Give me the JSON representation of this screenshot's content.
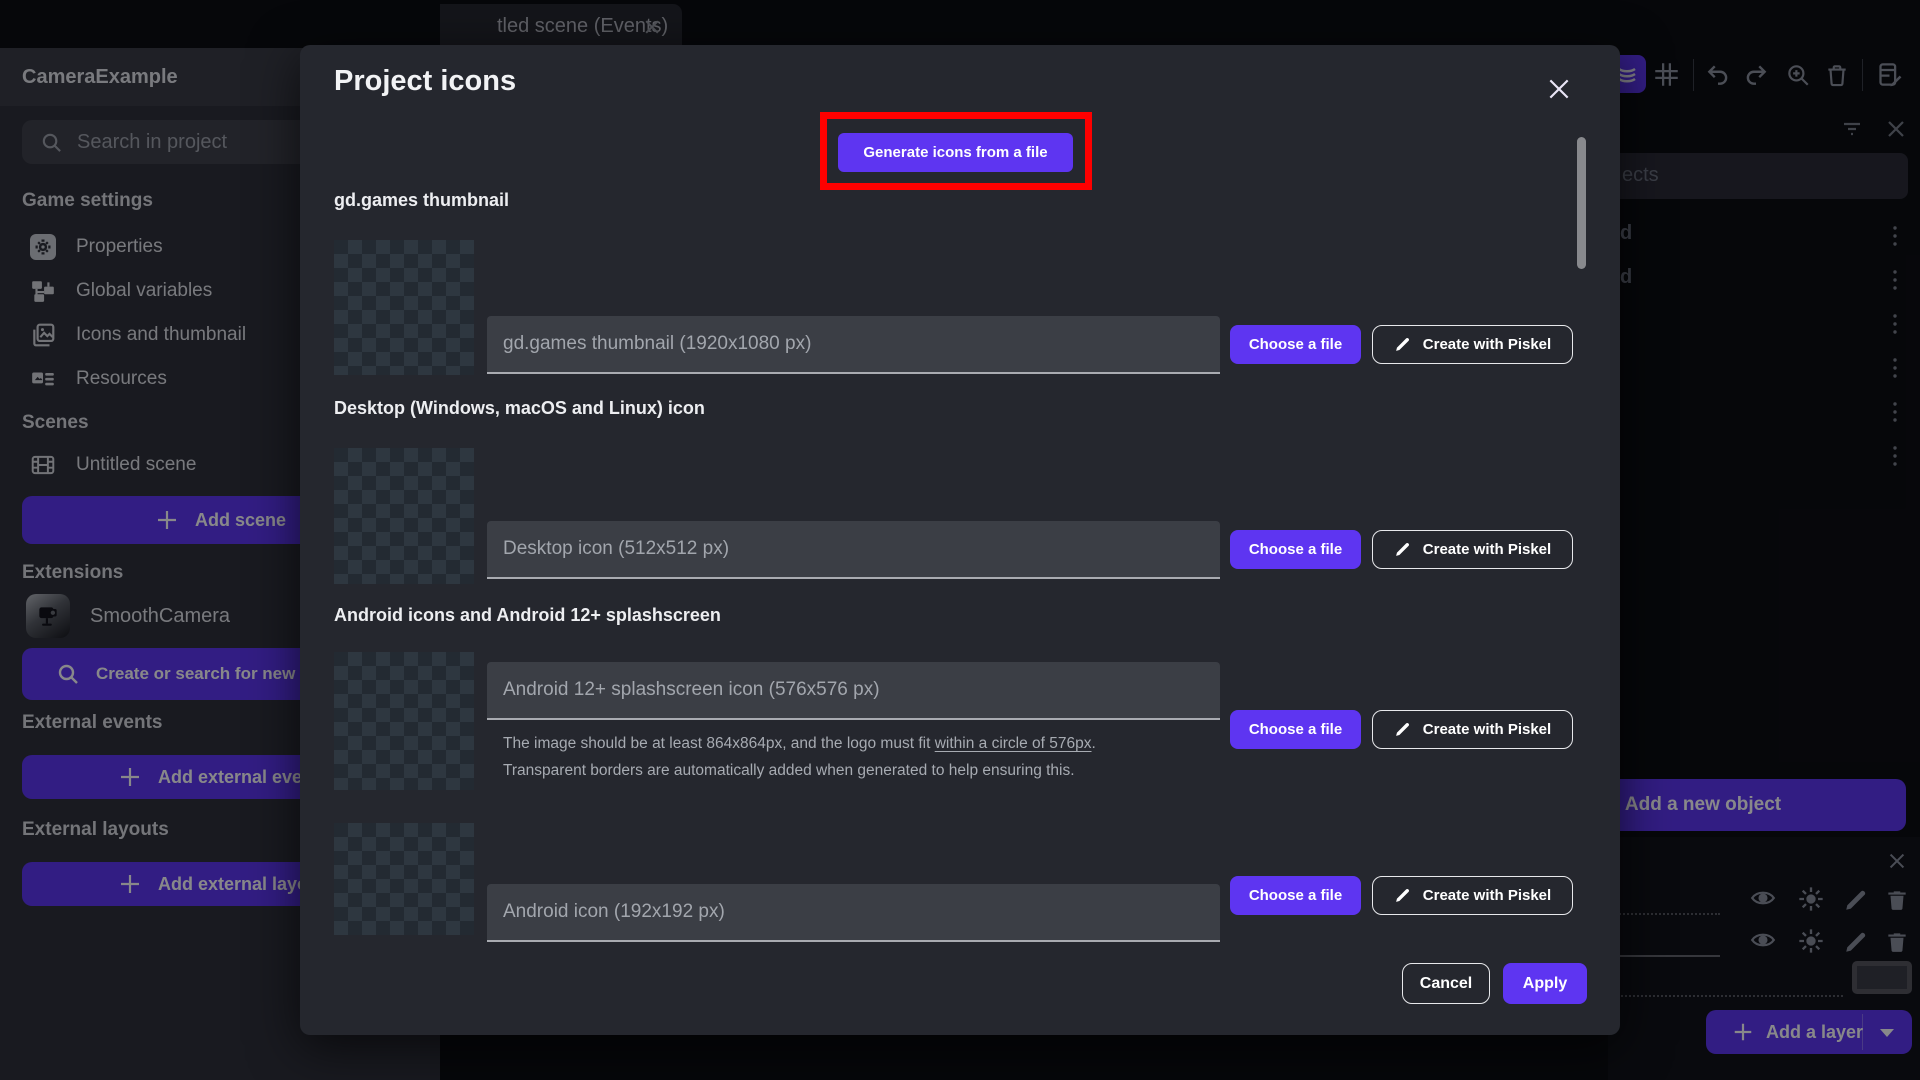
{
  "accent_color": "#5e35f1",
  "highlight_color": "#fe0000",
  "window": {
    "tab_label": "tled scene (Events)"
  },
  "sidebar": {
    "project_name": "CameraExample",
    "search_placeholder": "Search in project",
    "headers": {
      "game_settings": "Game settings",
      "scenes": "Scenes",
      "extensions": "Extensions",
      "external_events": "External events",
      "external_layouts": "External layouts"
    },
    "items": {
      "properties": "Properties",
      "global_variables": "Global variables",
      "icons_thumbnail": "Icons and thumbnail",
      "resources": "Resources",
      "untitled_scene": "Untitled scene",
      "smooth_camera": "SmoothCamera"
    },
    "buttons": {
      "add_scene": "Add scene",
      "create_search": "Create or search for new e",
      "add_external_event": "Add external even",
      "add_external_layout": "Add external layou"
    }
  },
  "modal": {
    "title": "Project icons",
    "generate_button": "Generate icons from a file",
    "choose_label": "Choose a file",
    "piskel_label": "Create with Piskel",
    "cancel_label": "Cancel",
    "apply_label": "Apply",
    "section_labels": {
      "gdgames": "gd.games thumbnail",
      "desktop": "Desktop (Windows, macOS and Linux) icon",
      "android": "Android icons and Android 12+ splashscreen"
    },
    "hints": {
      "gdgames": "gd.games thumbnail (1920x1080 px)",
      "desktop": "Desktop icon (512x512 px)",
      "splashscreen": "Android 12+ splashscreen icon (576x576 px)",
      "android_icon": "Android icon (192x192 px)"
    },
    "helper": {
      "line1_pre": "The image should be at least 864x864px, and the logo must fit ",
      "line1_underlined": "within a circle of 576px",
      "line1_post": ".",
      "line2": "Transparent borders are automatically added when generated to help ensuring this."
    }
  },
  "right_panel": {
    "objects_search_fragment": "ects",
    "object_row_fragment_1": "d",
    "object_row_fragment_2": "d",
    "add_new_object": "Add a new object",
    "add_layer": "Add a layer"
  }
}
